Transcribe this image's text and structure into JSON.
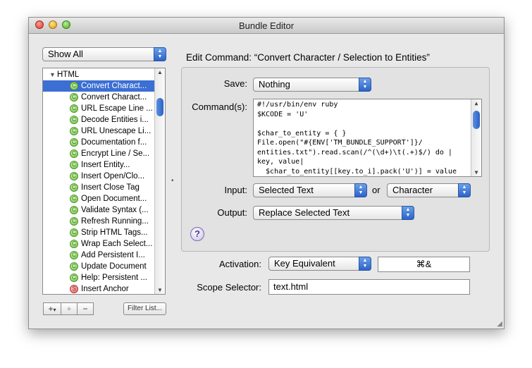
{
  "window": {
    "title": "Bundle Editor"
  },
  "sidebar": {
    "filter_popup": "Show All",
    "group": "HTML",
    "items": [
      {
        "label": "Convert Charact...",
        "selected": true,
        "icon": "command-icon"
      },
      {
        "label": "Convert Charact...",
        "icon": "command-icon"
      },
      {
        "label": "URL Escape Line ...",
        "icon": "command-icon"
      },
      {
        "label": "Decode Entities i...",
        "icon": "command-icon"
      },
      {
        "label": "URL Unescape Li...",
        "icon": "command-icon"
      },
      {
        "label": "Documentation f...",
        "icon": "command-icon"
      },
      {
        "label": "Encrypt Line / Se...",
        "icon": "command-icon"
      },
      {
        "label": "Insert Entity...",
        "icon": "command-icon"
      },
      {
        "label": "Insert Open/Clo...",
        "icon": "command-icon"
      },
      {
        "label": "Insert Close Tag",
        "icon": "command-icon"
      },
      {
        "label": "Open Document...",
        "icon": "command-icon"
      },
      {
        "label": "Validate Syntax (...",
        "icon": "command-icon"
      },
      {
        "label": "Refresh Running...",
        "icon": "command-icon"
      },
      {
        "label": "Strip HTML Tags...",
        "icon": "command-icon"
      },
      {
        "label": "Wrap Each Select...",
        "icon": "command-icon"
      },
      {
        "label": "Add Persistent I...",
        "icon": "command-icon"
      },
      {
        "label": "Update Document",
        "icon": "command-icon"
      },
      {
        "label": "Help: Persistent ...",
        "icon": "command-icon"
      },
      {
        "label": "Insert Anchor",
        "icon": "snippet-icon"
      }
    ],
    "add_button": "+",
    "add_menu_glyph": "▾",
    "add_item_button": "+",
    "remove_button": "−",
    "filter_button": "Filter List..."
  },
  "editor": {
    "heading": "Edit Command: “Convert Character / Selection to Entities”",
    "save_label": "Save:",
    "save_value": "Nothing",
    "command_label": "Command(s):",
    "command_lines": [
      "#!/usr/bin/env ruby",
      "$KCODE = 'U'",
      "",
      "$char_to_entity = { }",
      "File.open(\"#{ENV['TM_BUNDLE_SUPPORT']}/",
      "entities.txt\").read.scan(/^(\\d+)\\t(.+)$/) do |",
      "key, value|",
      "  $char_to_entity[[key.to_i].pack('U')] = value"
    ],
    "input_label": "Input:",
    "input_value": "Selected Text",
    "or_label": "or",
    "input_fallback": "Character",
    "output_label": "Output:",
    "output_value": "Replace Selected Text",
    "help_glyph": "?",
    "activation_label": "Activation:",
    "activation_value": "Key Equivalent",
    "key_equivalent": "⌘&",
    "scope_label": "Scope Selector:",
    "scope_value": "text.html"
  }
}
